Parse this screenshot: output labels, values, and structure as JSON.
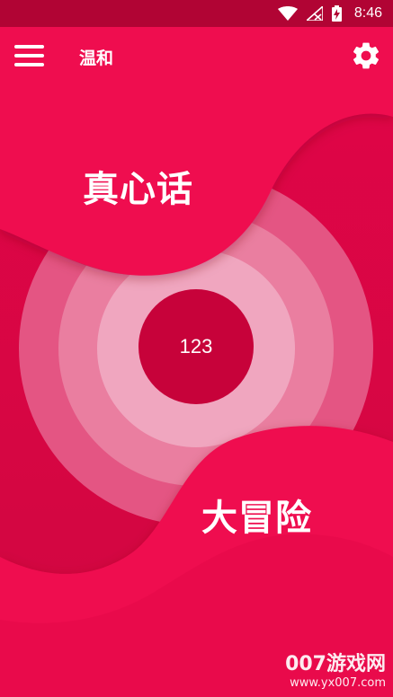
{
  "status_bar": {
    "time": "8:46",
    "icons": [
      "wifi-icon",
      "no-signal-icon",
      "battery-charging-icon"
    ]
  },
  "app_bar": {
    "title": "温和",
    "menu_icon": "hamburger-menu-icon",
    "settings_icon": "gear-icon"
  },
  "main": {
    "truth_label": "真心话",
    "dare_label": "大冒险",
    "center_value": "123"
  },
  "watermark": {
    "main": "007游戏网",
    "sub": "www.yx007.com"
  },
  "colors": {
    "background": "#d9063f",
    "status_bar": "#b10434",
    "wave": "#ef0d50",
    "ring_outer": "#e45583",
    "ring_middle": "#ea7ea0",
    "ring_inner": "#f0a6bf",
    "center_circle": "#c7023a"
  }
}
